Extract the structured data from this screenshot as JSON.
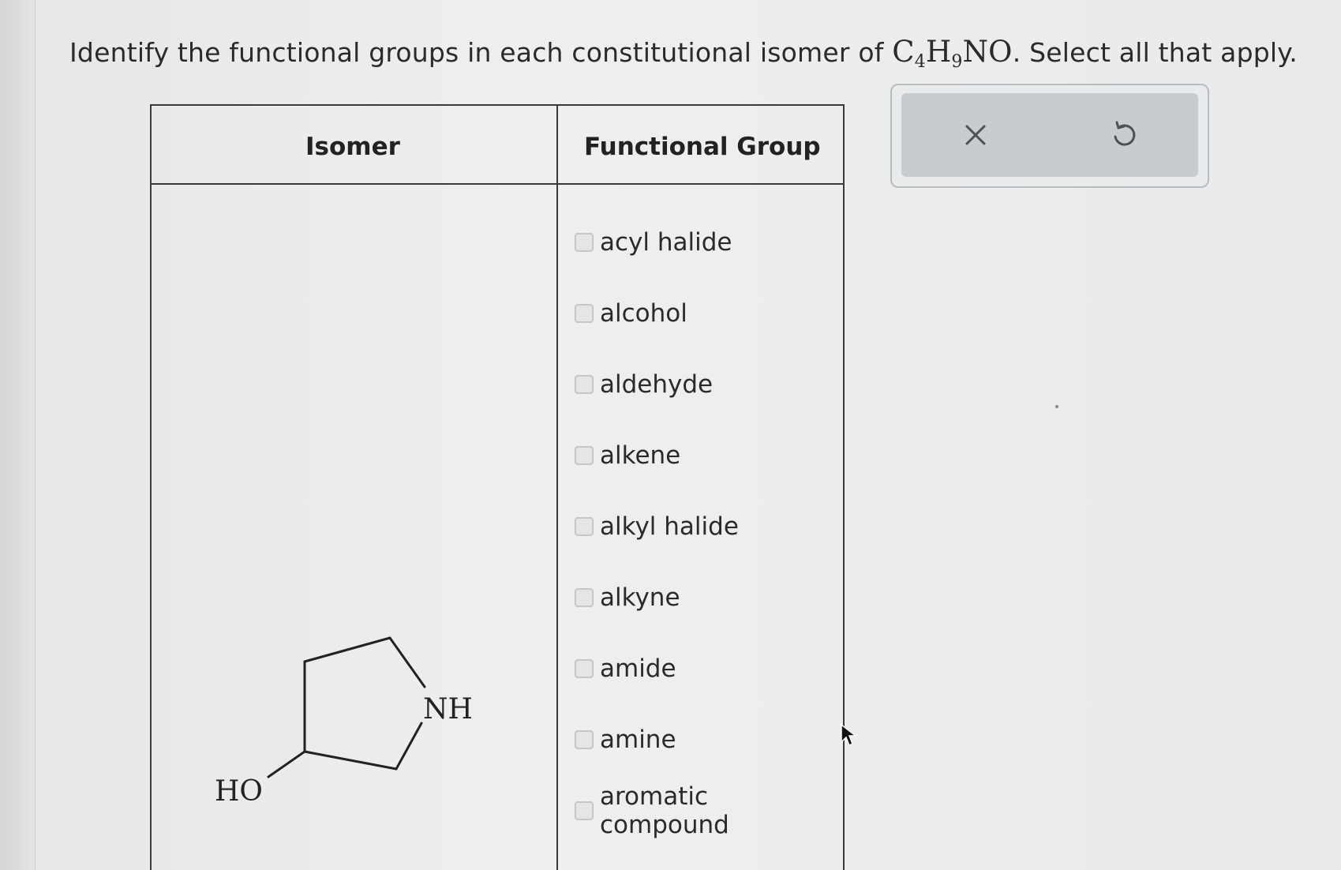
{
  "question": {
    "prefix": "Identify the functional groups in each constitutional isomer of ",
    "formula": {
      "c": "C",
      "c_count": "4",
      "h": "H",
      "h_count": "9",
      "rest": "NO"
    },
    "suffix": ". Select all that apply."
  },
  "table": {
    "headers": {
      "isomer": "Isomer",
      "functional_group": "Functional Group"
    },
    "options": [
      {
        "label": "acyl halide",
        "checked": false
      },
      {
        "label": "alcohol",
        "checked": false
      },
      {
        "label": "aldehyde",
        "checked": false
      },
      {
        "label": "alkene",
        "checked": false
      },
      {
        "label": "alkyl halide",
        "checked": false
      },
      {
        "label": "alkyne",
        "checked": false
      },
      {
        "label": "amide",
        "checked": false
      },
      {
        "label": "amine",
        "checked": false
      },
      {
        "label": "aromatic compound",
        "checked": false
      }
    ],
    "molecule": {
      "nh_label": "NH",
      "ho_label": "HO"
    }
  },
  "actions": {
    "clear_icon": "x-icon",
    "undo_icon": "undo-icon"
  },
  "colors": {
    "icon": "#4d5256",
    "border": "#3a3a3a"
  }
}
